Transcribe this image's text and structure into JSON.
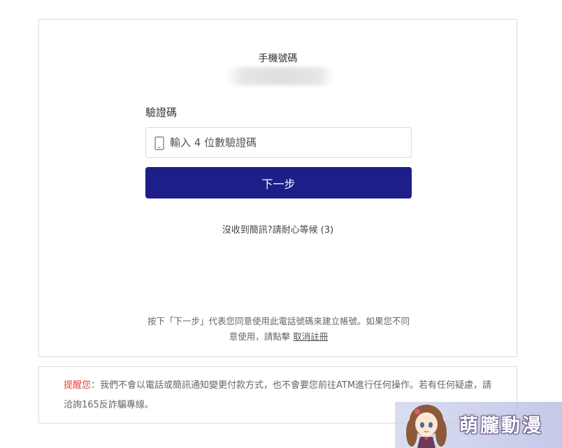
{
  "form": {
    "phone_label": "手機號碼",
    "phone_number": "",
    "code_label": "驗證碼",
    "code_placeholder": "輸入 4 位數驗證碼",
    "code_value": "",
    "input_icon": "mobile-phone-icon",
    "next_button_label": "下一步",
    "resend_text": "沒收到簡訊?請耐心等候 (3)",
    "consent_text": "按下「下一步」代表您同意使用此電話號碼來建立帳號。如果您不同意使用，請點擊",
    "cancel_link_label": "取消註冊"
  },
  "notice": {
    "prefix": "提醒您",
    "body": "：我們不會以電話或簡訊通知變更付款方式，也不會要您前往ATM進行任何操作。若有任何疑慮，請洽詢165反詐騙專線。"
  },
  "watermark": {
    "text": "萌朧動漫"
  },
  "colors": {
    "primary_button": "#1e1e88",
    "notice_prefix": "#e04040",
    "border": "#dcdcdc"
  }
}
